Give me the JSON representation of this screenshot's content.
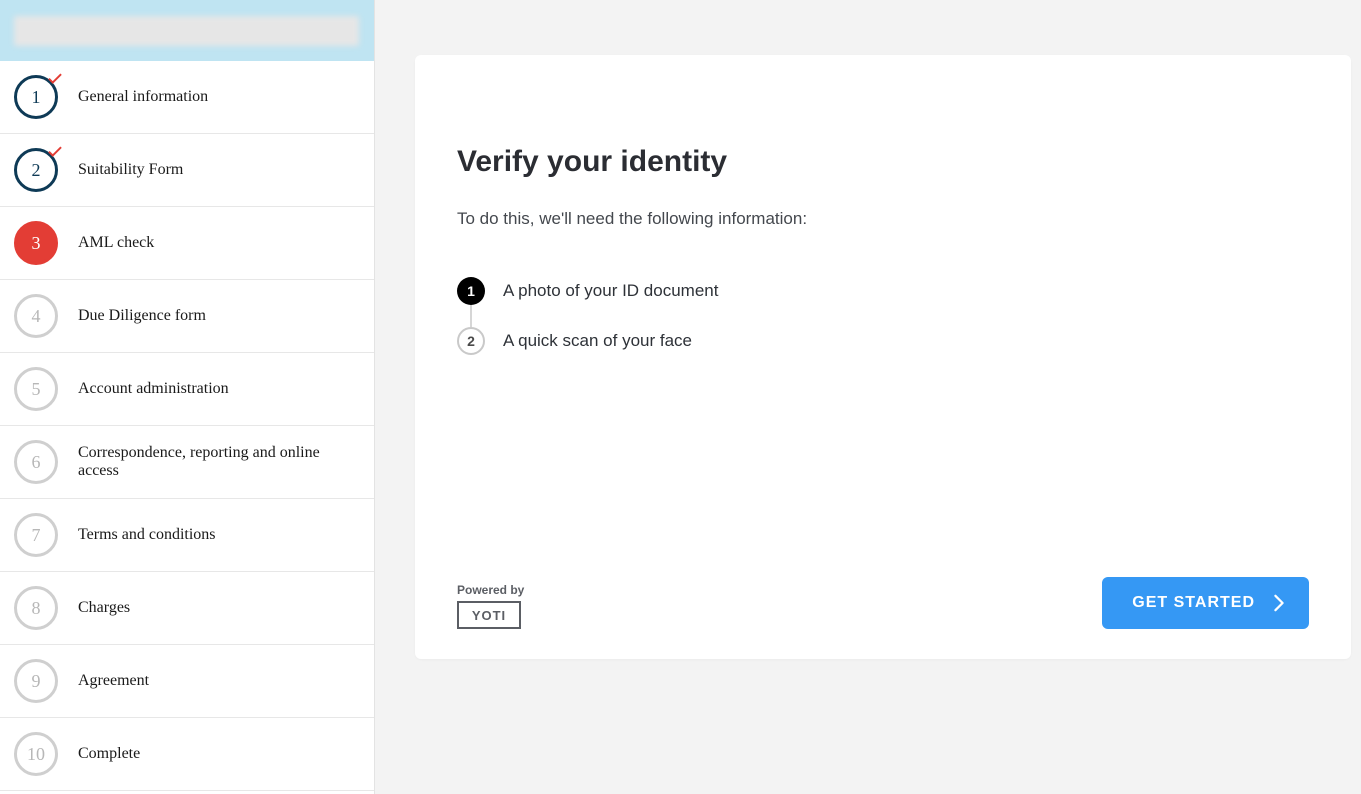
{
  "sidebar": {
    "steps": [
      {
        "num": "1",
        "label": "General information",
        "state": "completed"
      },
      {
        "num": "2",
        "label": "Suitability Form",
        "state": "completed"
      },
      {
        "num": "3",
        "label": "AML check",
        "state": "active"
      },
      {
        "num": "4",
        "label": "Due Diligence form",
        "state": "pending"
      },
      {
        "num": "5",
        "label": "Account administration",
        "state": "pending"
      },
      {
        "num": "6",
        "label": "Correspondence, reporting and online access",
        "state": "pending"
      },
      {
        "num": "7",
        "label": "Terms and conditions",
        "state": "pending"
      },
      {
        "num": "8",
        "label": "Charges",
        "state": "pending"
      },
      {
        "num": "9",
        "label": "Agreement",
        "state": "pending"
      },
      {
        "num": "10",
        "label": "Complete",
        "state": "pending"
      }
    ]
  },
  "main": {
    "title": "Verify your identity",
    "subtitle": "To do this, we'll need the following information:",
    "requirements": [
      {
        "num": "1",
        "text": "A photo of your ID document",
        "style": "filled"
      },
      {
        "num": "2",
        "text": "A quick scan of your face",
        "style": "outline"
      }
    ],
    "poweredByLabel": "Powered by",
    "poweredByBrand": "YOTI",
    "ctaLabel": "GET STARTED"
  }
}
